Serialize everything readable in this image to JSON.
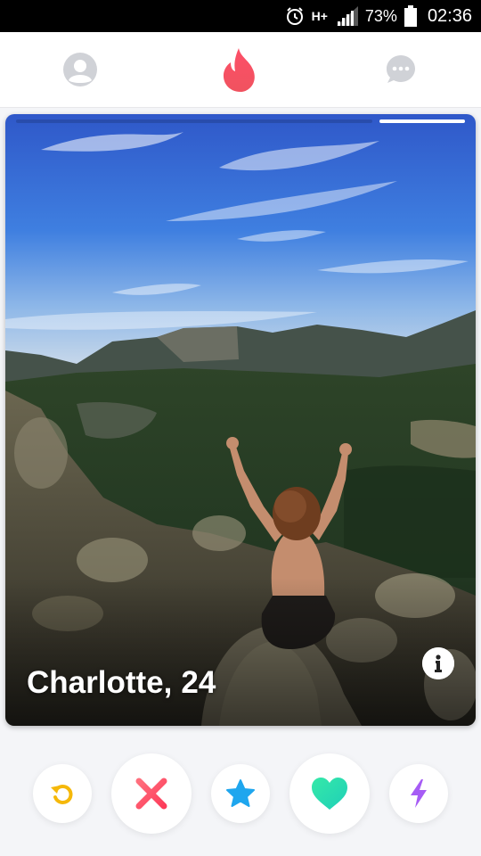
{
  "status_bar": {
    "network": "H+",
    "battery": "73%",
    "time": "02:36"
  },
  "top_nav": {
    "profile_icon": "profile-icon",
    "flame_icon": "flame-icon",
    "messages_icon": "messages-icon"
  },
  "card": {
    "name": "Charlotte,",
    "age": "24",
    "photo_position": 1,
    "photo_count": 1
  },
  "actions": {
    "rewind": "rewind-icon",
    "nope": "close-icon",
    "superlike": "star-icon",
    "like": "heart-icon",
    "boost": "lightning-icon"
  },
  "colors": {
    "brand": "#fd5068",
    "rewind": "#f5b80a",
    "nope": "#fd4c63",
    "superlike": "#1fa6ee",
    "like": "#2ae2b0",
    "boost": "#a65cf5",
    "nav_inactive": "#d0d2d7"
  }
}
